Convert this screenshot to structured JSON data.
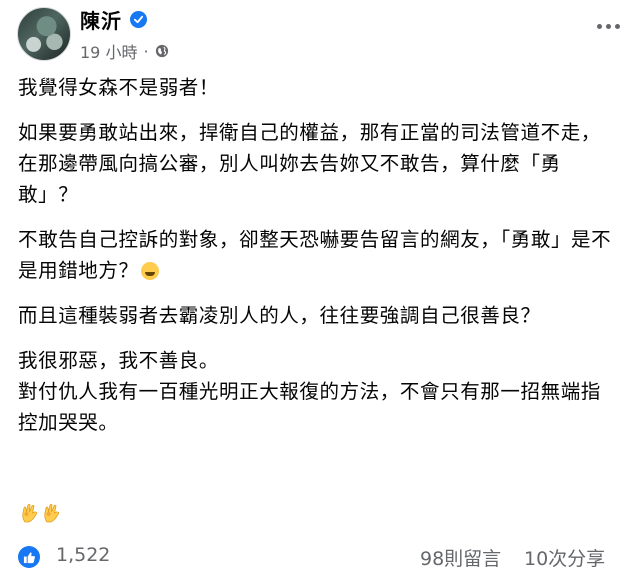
{
  "post": {
    "author": "陳沂",
    "time": "19 小時",
    "separator": "·",
    "paragraphs": [
      "我覺得女森不是弱者！",
      "如果要勇敢站出來，捍衛自己的權益，那有正當的司法管道不走，在那邊帶風向搞公審，別人叫妳去告妳又不敢告，算什麼「勇敢」？",
      "不敢告自己控訴的對象，卻整天恐嚇要告留言的網友，「勇敢」是不是用錯地方？",
      "而且這種裝弱者去霸凌別人的人，往往要強調自己很善良？",
      "我很邪惡，我不善良。\n對付仇人我有一百種光明正大報復的方法，不會只有那一招無端指控加哭哭。"
    ]
  },
  "footer": {
    "likes": "1,522",
    "comments": "98則留言",
    "shares": "10次分享"
  },
  "colors": {
    "accent": "#1877f2",
    "secondary_text": "#65676b",
    "primary_text": "#050505"
  },
  "icons": [
    "verified-badge-icon",
    "globe-icon",
    "more-options-icon",
    "laughing-emoji-icon",
    "ok-hand-icon",
    "like-icon"
  ]
}
